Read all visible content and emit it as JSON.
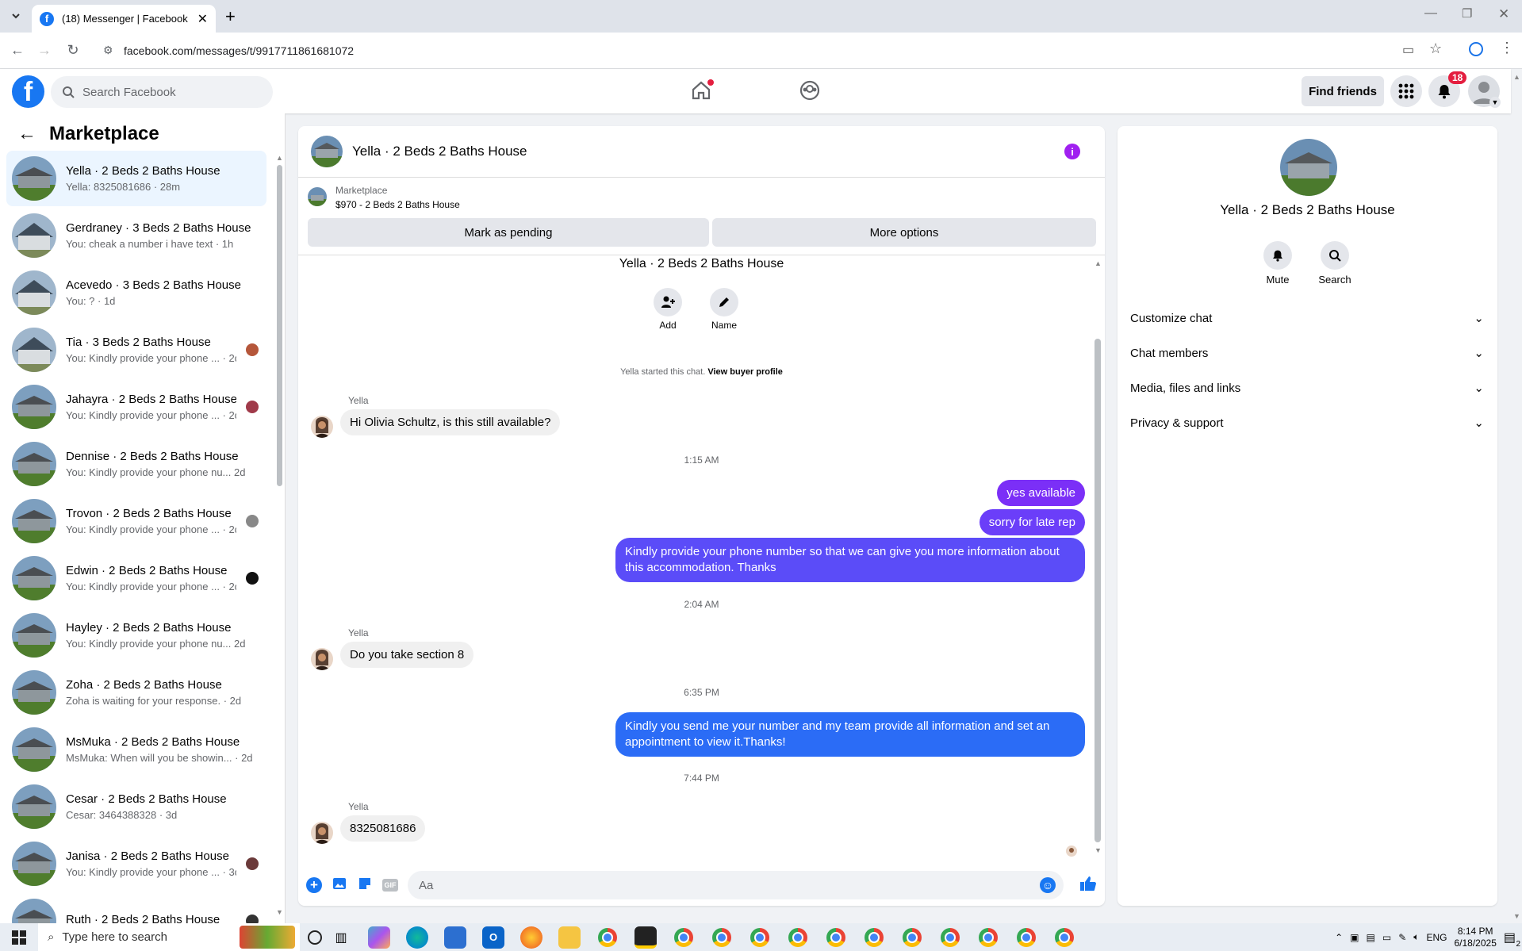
{
  "browser": {
    "tab_title": "(18) Messenger | Facebook",
    "url": "facebook.com/messages/t/9917711861681072"
  },
  "header": {
    "search_placeholder": "Search Facebook",
    "find_friends": "Find friends",
    "notifications_count": "18"
  },
  "sidebar": {
    "title": "Marketplace",
    "conversations": [
      {
        "name": "Yella · 2 Beds 2 Baths House",
        "preview": "Yella: 8325081686 · 28m",
        "selected": true
      },
      {
        "name": "Gerdraney · 3 Beds 2 Baths House",
        "preview": "You: cheak a number i have text · 1h"
      },
      {
        "name": "Acevedo · 3 Beds 2 Baths House",
        "preview": "You: ? · 1d"
      },
      {
        "name": "Tia · 3 Beds 2 Baths House",
        "preview": "You: Kindly provide your phone ... · 2d"
      },
      {
        "name": "Jahayra · 2 Beds 2 Baths House",
        "preview": "You: Kindly provide your phone ... · 2d"
      },
      {
        "name": "Dennise · 2 Beds 2 Baths House",
        "preview": "You: Kindly provide your phone nu... 2d"
      },
      {
        "name": "Trovon · 2 Beds 2 Baths House",
        "preview": "You: Kindly provide your phone ... · 2d"
      },
      {
        "name": "Edwin · 2 Beds 2 Baths House",
        "preview": "You: Kindly provide your phone ... · 2d"
      },
      {
        "name": "Hayley · 2 Beds 2 Baths House",
        "preview": "You: Kindly provide your phone nu... 2d"
      },
      {
        "name": "Zoha · 2 Beds 2 Baths House",
        "preview": "Zoha is waiting for your response. · 2d"
      },
      {
        "name": "MsMuka · 2 Beds 2 Baths House",
        "preview": "MsMuka: When will you be showin... · 2d"
      },
      {
        "name": "Cesar · 2 Beds 2 Baths House",
        "preview": "Cesar: 3464388328 · 3d"
      },
      {
        "name": "Janisa · 2 Beds 2 Baths House",
        "preview": "You: Kindly provide your phone ... · 3d"
      },
      {
        "name": "Ruth · 2 Beds 2 Baths House",
        "preview": ""
      }
    ]
  },
  "chat": {
    "title": "Yella · 2 Beds 2 Baths House",
    "listing_source": "Marketplace",
    "listing_title": "$970 - 2 Beds 2 Baths House",
    "mark_pending": "Mark as pending",
    "more_options": "More options",
    "intro_title": "Yella · 2 Beds 2 Baths House",
    "add_label": "Add",
    "name_label": "Name",
    "started_text": "Yella started this chat.",
    "view_buyer_profile": "View buyer profile",
    "sender": "Yella",
    "msg1": "Hi Olivia Schultz, is this still available?",
    "time1": "1:15 AM",
    "out1": "yes available",
    "out2": "sorry for late rep",
    "out3": "Kindly provide your phone number so that we can give you more information about this accommodation. Thanks",
    "time2": "2:04 AM",
    "msg2": "Do you take section 8",
    "time3": "6:35 PM",
    "out4": "Kindly you send me your number and my team provide all information and set an appointment to view it.Thanks!",
    "time4": "7:44 PM",
    "msg3": "8325081686",
    "composer_placeholder": "Aa"
  },
  "details": {
    "title": "Yella · 2 Beds 2 Baths House",
    "mute": "Mute",
    "search": "Search",
    "sections": [
      "Customize chat",
      "Chat members",
      "Media, files and links",
      "Privacy & support"
    ]
  },
  "taskbar": {
    "search_placeholder": "Type here to search",
    "lang": "ENG",
    "time": "8:14 PM",
    "date": "6/18/2025",
    "notif": "2"
  },
  "colors": {
    "accent": "#1877f2",
    "bubble_purple": "#7b2ff7",
    "bubble_blue": "#2b6cf6",
    "info_purple": "#a020f0"
  }
}
